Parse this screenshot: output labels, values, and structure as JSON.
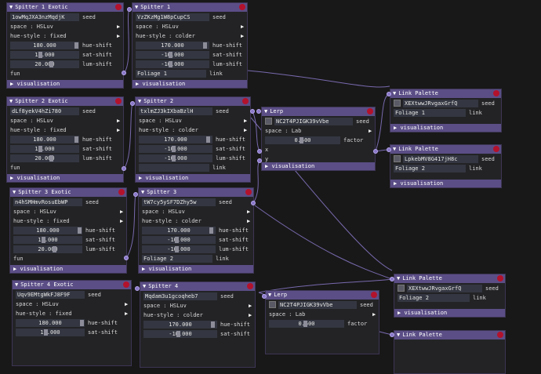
{
  "ui": {
    "seed": "seed",
    "space": "space : HSLuv",
    "space_lab": "space : Lab",
    "hue_style_fixed": "hue-style : fixed",
    "hue_style_colder": "hue-style : colder",
    "hue_shift": "hue-shift",
    "sat_shift": "sat-shift",
    "lum_shift": "lum-shift",
    "fun": "fun",
    "link": "link",
    "factor": "factor",
    "x": "x",
    "y": "y",
    "visualisation": "visualisation",
    "tri": "▼",
    "play": "▶"
  },
  "exotic": [
    {
      "title": "Spitter 1 Exotic",
      "seed": "1owMqJXA3nzMqdjK",
      "hue": "180.000",
      "sat": "10.000",
      "lum": "20.000"
    },
    {
      "title": "Spitter 2 Exotic",
      "seed": "dLf8yekV4hZi780",
      "hue": "180.000",
      "sat": "10.000",
      "lum": "20.000"
    },
    {
      "title": "Spitter 3 Exotic",
      "seed": "n4hSMHmvRosuEbWP",
      "hue": "180.000",
      "sat": "10.000",
      "lum": "20.000"
    },
    {
      "title": "Spitter 4 Exotic",
      "seed": "Uqv9EMtgWkFJ8F9F",
      "hue": "180.000",
      "sat": "10.000",
      "lum": ""
    }
  ],
  "spitters": [
    {
      "title": "Spitter 1",
      "seed": "VzZKzMg1W8pCupCS",
      "hue": "170.000",
      "sat": "-10.000",
      "lum": "-10.000",
      "foliage": "Foliage 1"
    },
    {
      "title": "Spitter 2",
      "seed": "txlmZJ3kIXbaBzlH",
      "hue": "170.000",
      "sat": "-10.000",
      "lum": "-10.000",
      "foliage": ""
    },
    {
      "title": "Spitter 3",
      "seed": "tW7cy5ySF7DZhy5w",
      "hue": "170.000",
      "sat": "-10.000",
      "lum": "-10.000",
      "foliage": "Foliage 2"
    },
    {
      "title": "Spitter 4",
      "seed": "Mqdam3u1gcoqheb7",
      "hue": "170.000",
      "sat": "-10.000",
      "lum": "",
      "foliage": ""
    }
  ],
  "lerps": [
    {
      "title": "Lerp",
      "seed": "NC2T4PJIGK39vVbe",
      "factor": "0.500"
    },
    {
      "title": "Lerp",
      "seed": "NC2T4PJIGK39vVbe",
      "factor": "0.500"
    }
  ],
  "palettes": [
    {
      "title": "Link Palette",
      "seed": "XEXtwwJRvgaxGrfQ",
      "foliage": "Foliage 1"
    },
    {
      "title": "Link Palette",
      "seed": "LpkebMV8G417jH8c",
      "foliage": "Foliage 2"
    },
    {
      "title": "Link Palette",
      "seed": "XEXtwwJRvgaxGrfQ",
      "foliage": "Foliage 2"
    },
    {
      "title": "Link Palette",
      "seed": "",
      "foliage": ""
    }
  ],
  "colors": {
    "header": "#5b4e86",
    "close": "#b3122c",
    "wire": "#8a78c8",
    "field": "#343741"
  }
}
